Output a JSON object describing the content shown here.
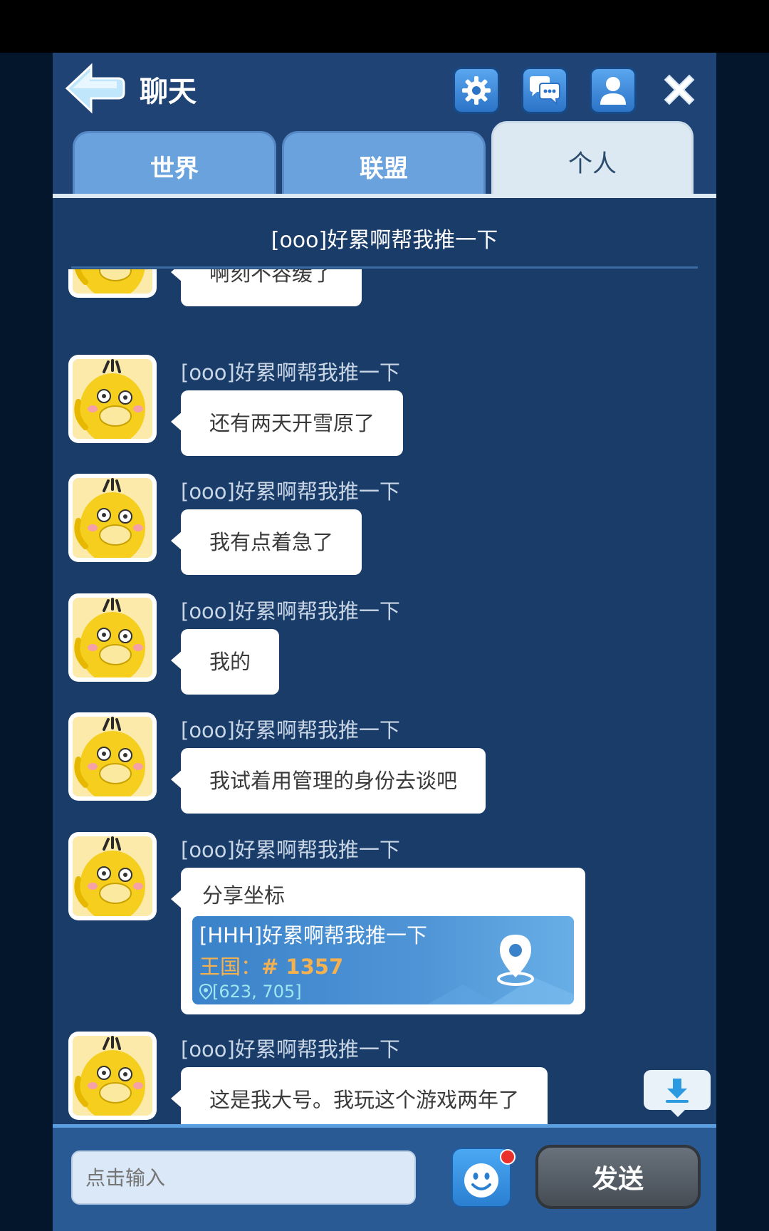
{
  "header": {
    "title": "聊天",
    "icons": [
      "back-arrow-icon",
      "gear-icon",
      "chat-bubbles-icon",
      "person-icon",
      "close-icon"
    ]
  },
  "tabs": [
    {
      "label": "世界",
      "active": false
    },
    {
      "label": "联盟",
      "active": false
    },
    {
      "label": "个人",
      "active": true
    }
  ],
  "chat": {
    "title": "[ooo]好累啊帮我推一下",
    "messages": [
      {
        "sender": "",
        "text": "啊刻不容缓了"
      },
      {
        "sender": "[ooo]好累啊帮我推一下",
        "text": "还有两天开雪原了"
      },
      {
        "sender": "[ooo]好累啊帮我推一下",
        "text": "我有点着急了"
      },
      {
        "sender": "[ooo]好累啊帮我推一下",
        "text": "我的"
      },
      {
        "sender": "[ooo]好累啊帮我推一下",
        "text": "我试着用管理的身份去谈吧"
      },
      {
        "sender": "[ooo]好累啊帮我推一下",
        "share": {
          "label": "分享坐标",
          "name": "[HHH]好累啊帮我推一下",
          "kingdom_label": "王国：",
          "kingdom_value": "# 1357",
          "coords": "[623, 705]"
        }
      },
      {
        "sender": "[ooo]好累啊帮我推一下",
        "text": "这是我大号。我玩这个游戏两年了"
      }
    ]
  },
  "input": {
    "placeholder": "点击输入",
    "send_label": "发送",
    "has_notification": true
  },
  "colors": {
    "panel_bg": "#1a3c69",
    "tab_inactive": "#6aa2de",
    "tab_active": "#dde9f2",
    "bubble": "#ffffff",
    "kingdom_text": "#f5b04f",
    "coords_text": "#9fe7ef",
    "notification": "#e9302c"
  }
}
